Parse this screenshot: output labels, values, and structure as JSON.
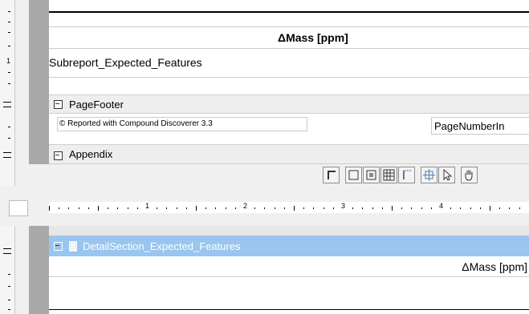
{
  "top_report": {
    "column_header": "ΔMass [ppm]",
    "subreport_label": "Subreport_Expected_Features",
    "ruler_number": "1"
  },
  "page_footer": {
    "section_label": "PageFooter",
    "copyright_text": "© Reported with Compound Discoverer  3.3",
    "page_number_field": "PageNumberIn"
  },
  "appendix": {
    "section_label": "Appendix"
  },
  "toolbar": {
    "buttons": [
      "label-tool-icon",
      "rectangle-tool-icon",
      "grid-tool-icon",
      "table-tool-icon",
      "line-tool-icon",
      "crosshair-tool-icon",
      "pointer-tool-icon",
      "hand-tool-icon"
    ]
  },
  "horizontal_ruler": {
    "numbers": [
      "1",
      "2",
      "3",
      "4"
    ]
  },
  "subreport": {
    "section_label": "DetailSection_Expected_Features",
    "column_header": "ΔMass [ppm]"
  },
  "colors": {
    "selected_header_bg": "#99c5ee",
    "gutter": "#a9a9a9"
  }
}
